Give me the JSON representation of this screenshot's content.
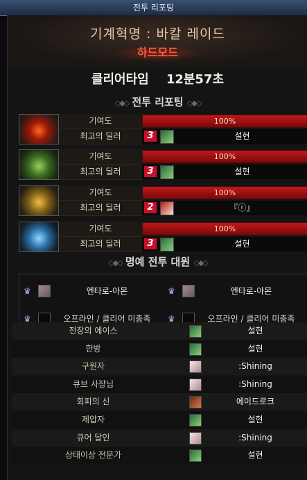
{
  "window": {
    "title": "전투 리포팅"
  },
  "raid": {
    "title": "기계혁명 : 바칼 레이드",
    "mode": "하드모드"
  },
  "clear": {
    "label": "클리어타임",
    "time": "12분57초"
  },
  "sections": {
    "battle_report": "전투 리포팅",
    "honor": "명예 전투 대원"
  },
  "labels": {
    "contribution": "기여도",
    "best_dealer": "최고의 딜러"
  },
  "parties": [
    {
      "portrait": "red-dragon-icon",
      "contribution": "100%",
      "contribution_value": 100,
      "rank": "3",
      "dealer": "설현",
      "dealer_icon": "green"
    },
    {
      "portrait": "green-dragon-icon",
      "contribution": "100%",
      "contribution_value": 100,
      "rank": "3",
      "dealer": "설현",
      "dealer_icon": "green"
    },
    {
      "portrait": "gold-dragon-icon",
      "contribution": "100%",
      "contribution_value": 100,
      "rank": "2",
      "dealer": "『ⓡ』",
      "dealer_icon": "red"
    },
    {
      "portrait": "blue-dragon-icon",
      "contribution": "100%",
      "contribution_value": 100,
      "rank": "3",
      "dealer": "설현",
      "dealer_icon": "green"
    }
  ],
  "honor": [
    {
      "name": "엔타로-아몬",
      "status": "online"
    },
    {
      "name": "엔타로-아몬",
      "status": "online"
    },
    {
      "name": "오프라인 / 클리어 미충족",
      "status": "offline"
    },
    {
      "name": "오프라인 / 클리어 미충족",
      "status": "offline"
    }
  ],
  "awards": [
    {
      "title": "전장의 에이스",
      "player": "설현",
      "icon": "green"
    },
    {
      "title": "한방",
      "player": "설현",
      "icon": "green"
    },
    {
      "title": "구원자",
      "player": ":Shining",
      "icon": "white"
    },
    {
      "title": "큐브 사장님",
      "player": ":Shining",
      "icon": "white"
    },
    {
      "title": "회피의 신",
      "player": "에이드로크",
      "icon": "brown"
    },
    {
      "title": "제압자",
      "player": "설현",
      "icon": "green"
    },
    {
      "title": "큐어 달인",
      "player": ":Shining",
      "icon": "white"
    },
    {
      "title": "상태이상 전문가",
      "player": "설현",
      "icon": "green"
    }
  ],
  "colors": {
    "accent_red": "#c01818",
    "mode_red": "#ff5a3a",
    "title_gold": "#e2c9a2"
  }
}
